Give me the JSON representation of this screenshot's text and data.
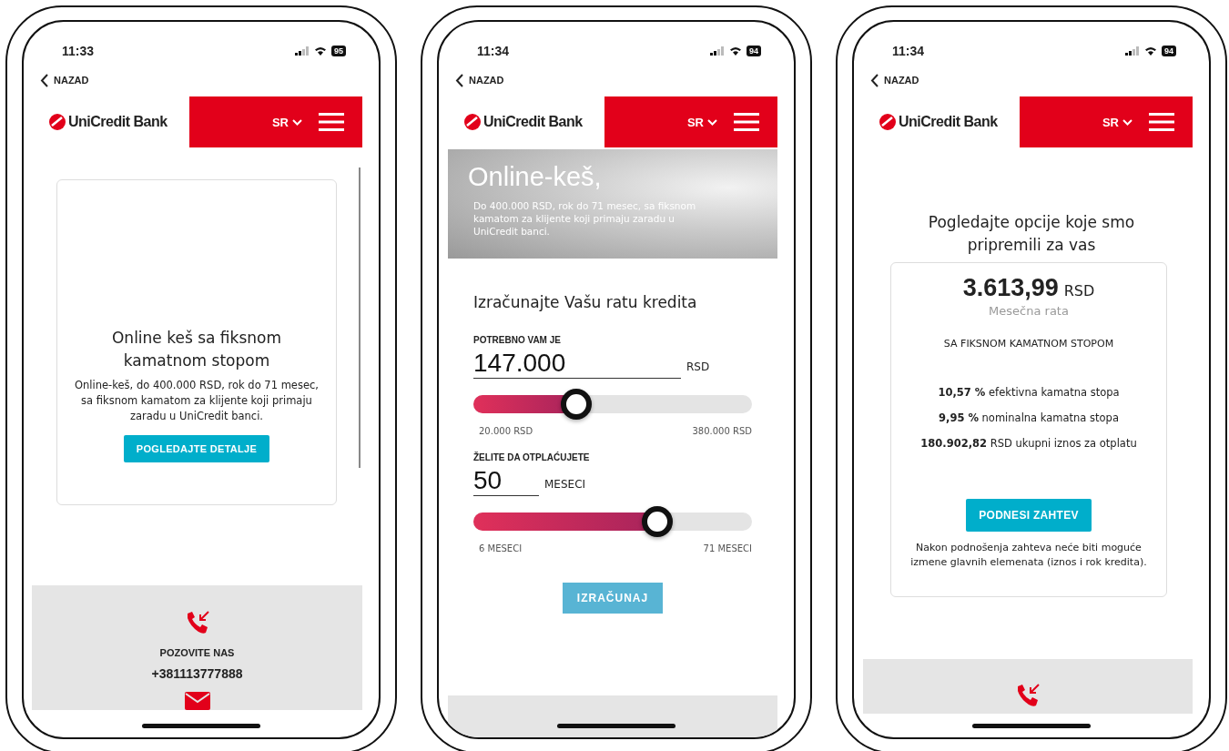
{
  "phones": [
    {
      "kind": "offer",
      "status": {
        "time": "11:33",
        "battery": "95"
      },
      "back": "NAZAD",
      "brand": "UniCredit Bank",
      "language": "SR",
      "card": {
        "title": "Online keš sa fiksnom kamatnom stopom",
        "text": "Online-keš, do 400.000 RSD, rok do 71 mesec, sa fiksnom kamatom za klijente koji primaju zaradu u UniCredit banci.",
        "button": "POGLEDAJTE DETALJE"
      },
      "contact": {
        "label": "POZOVITE NAS",
        "phone": "+381113777888"
      }
    },
    {
      "kind": "calculator",
      "status": {
        "time": "11:34",
        "battery": "94"
      },
      "back": "NAZAD",
      "brand": "UniCredit Bank",
      "language": "SR",
      "hero": {
        "title": "Online-keš,",
        "text": "Do 400.000 RSD, rok do 71 mesec, sa fiksnom kamatom za klijente koji primaju zaradu u UniCredit banci."
      },
      "heading": "Izračunajte Vašu ratu kredita",
      "fields": [
        {
          "label": "POTREBNO VAM JE",
          "value": "147.000",
          "unit": "RSD",
          "level": 0.37,
          "min": "20.000 RSD",
          "max": "380.000 RSD"
        },
        {
          "label": "ŽELITE DA OTPLAĆUJETE",
          "value": "50",
          "unit": "MESECI",
          "level": 0.66,
          "min": "6 MESECI",
          "max": "71 MESECI"
        }
      ],
      "button": "IZRAČUNAJ"
    },
    {
      "kind": "result",
      "status": {
        "time": "11:34",
        "battery": "94"
      },
      "back": "NAZAD",
      "brand": "UniCredit Bank",
      "language": "SR",
      "heading": "Pogledajte opcije koje smo pripremili za vas",
      "amount": "3.613,99",
      "currency": "RSD",
      "caption": "Mesečna rata",
      "rate_type": "SA FIKSNOM KAMATNOM STOPOM",
      "stats": [
        "**10,57 %** efektivna kamatna stopa",
        "**9,95 %** nominalna kamatna stopa",
        "**180.902,82** RSD ukupni iznos za otplatu"
      ],
      "button": "PODNESI ZAHTEV",
      "note": "Nakon podnošenja zahteva neće biti moguće izmene glavnih elemenata (iznos i rok kredita)."
    }
  ]
}
